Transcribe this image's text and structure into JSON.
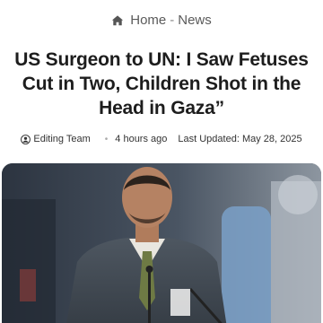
{
  "breadcrumb": {
    "home_label": "Home",
    "separator": "-",
    "section_label": "News"
  },
  "article": {
    "title": "US Surgeon to UN: I Saw Fetuses Cut in Two, Children Shot in the Head in Gaza”",
    "author": "Editing Team",
    "time_ago": "4 hours ago",
    "last_updated": "Last Updated: May 28, 2025"
  },
  "icons": {
    "home": "home-icon",
    "author": "user-circle-icon"
  },
  "colors": {
    "text_dark": "#1d1d1d",
    "text_muted": "#5a5a5a",
    "background": "#ffffff"
  }
}
